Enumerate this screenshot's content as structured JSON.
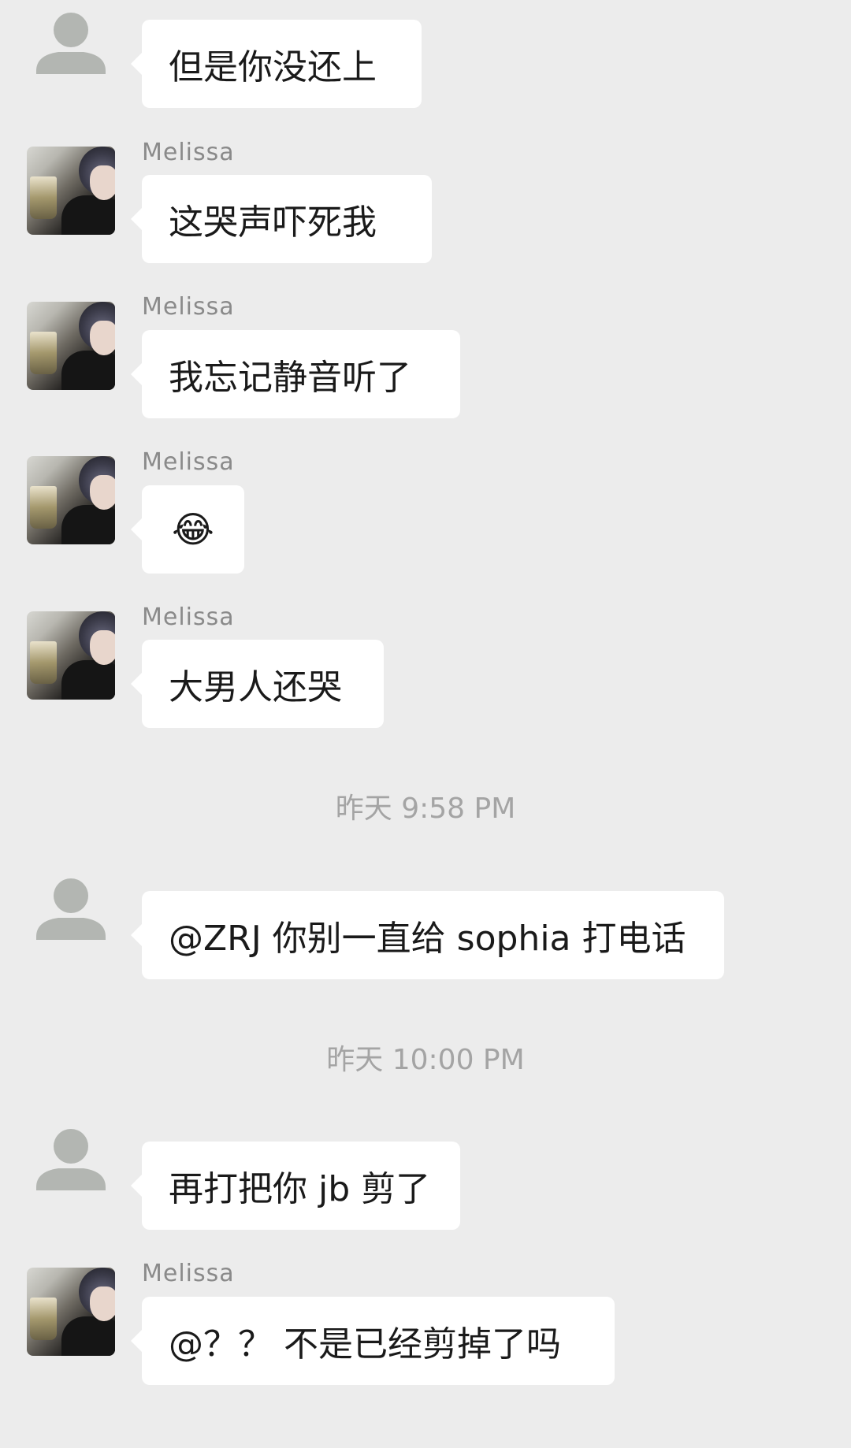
{
  "messages": [
    {
      "sender": "",
      "text": "但是你没还上",
      "avatar": "default-avatar"
    },
    {
      "sender": "Melissa",
      "text": "这哭声吓死我",
      "avatar": "photo-avatar"
    },
    {
      "sender": "Melissa",
      "text": "我忘记静音听了",
      "avatar": "photo-avatar"
    },
    {
      "sender": "Melissa",
      "text": "😂",
      "avatar": "photo-avatar"
    },
    {
      "sender": "Melissa",
      "text": "大男人还哭",
      "avatar": "photo-avatar"
    },
    {
      "sender": "",
      "text": "@ZRJ 你别一直给 sophia 打电话",
      "avatar": "default-avatar"
    },
    {
      "sender": "",
      "text": "再打把你 jb 剪了",
      "avatar": "default-avatar"
    },
    {
      "sender": "Melissa",
      "text": "@？？ 不是已经剪掉了吗",
      "avatar": "photo-avatar"
    }
  ],
  "timestamps": [
    "昨天 9:58 PM",
    "昨天 10:00 PM"
  ],
  "colors": {
    "background": "#ececec",
    "bubble": "#ffffff",
    "sender_name": "#8a8a8a",
    "timestamp": "#a4a4a4",
    "default_avatar": "#b3b6b2"
  }
}
